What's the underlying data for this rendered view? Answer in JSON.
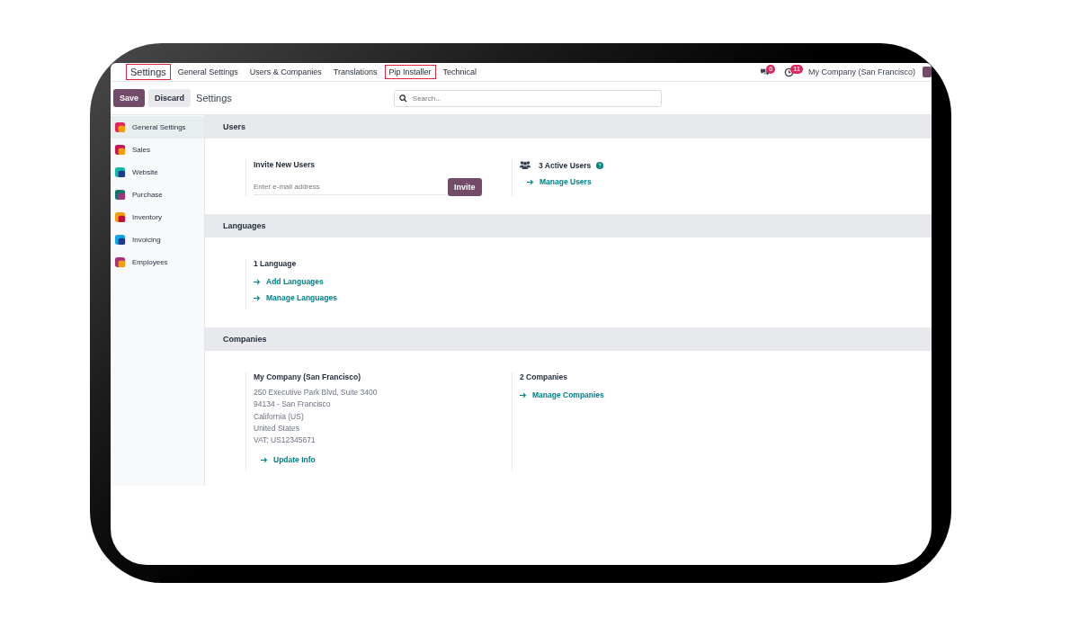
{
  "navbar": {
    "brand": {
      "label": "Settings",
      "highlighted": true
    },
    "menus": [
      {
        "label": "General Settings",
        "highlighted": false
      },
      {
        "label": "Users & Companies",
        "highlighted": false
      },
      {
        "label": "Translations",
        "highlighted": false
      },
      {
        "label": "Pip Installer",
        "highlighted": true
      },
      {
        "label": "Technical",
        "highlighted": false
      }
    ],
    "messages_count": "6",
    "activities_count": "11",
    "company": "My Company (San Francisco)"
  },
  "control_panel": {
    "buttons": [
      {
        "label": "Save",
        "kind": "primary"
      },
      {
        "label": "Discard",
        "kind": "secondary"
      }
    ],
    "title": "Settings",
    "search": {
      "placeholder": "Search..."
    }
  },
  "sidebar": {
    "items": [
      {
        "label": "General Settings",
        "selected": true
      },
      {
        "label": "Sales",
        "selected": false
      },
      {
        "label": "Website",
        "selected": false
      },
      {
        "label": "Purchase",
        "selected": false
      },
      {
        "label": "Inventory",
        "selected": false
      },
      {
        "label": "Invoicing",
        "selected": false
      },
      {
        "label": "Employees",
        "selected": false
      }
    ]
  },
  "sections": [
    {
      "title": "Users",
      "settings": [
        {
          "kind": "invite",
          "title": "Invite New Users",
          "placeholder": "Enter e-mail address",
          "button": "Invite"
        },
        {
          "kind": "users",
          "title": "3 Active Users",
          "help": true,
          "links": [
            "Manage Users"
          ]
        }
      ]
    },
    {
      "title": "Languages",
      "settings": [
        {
          "kind": "links",
          "title": "1 Language",
          "links": [
            "Add Languages",
            "Manage Languages"
          ]
        }
      ]
    },
    {
      "title": "Companies",
      "settings": [
        {
          "kind": "address",
          "title": "My Company (San Francisco)",
          "lines": [
            "250 Executive Park Blvd, Suite 3400",
            "94134 - San Francisco",
            "California (US)",
            "United States",
            "VAT: US12345671"
          ],
          "links": [
            "Update Info"
          ]
        },
        {
          "kind": "links",
          "title": "2 Companies",
          "links": [
            "Manage Companies"
          ]
        }
      ]
    }
  ]
}
